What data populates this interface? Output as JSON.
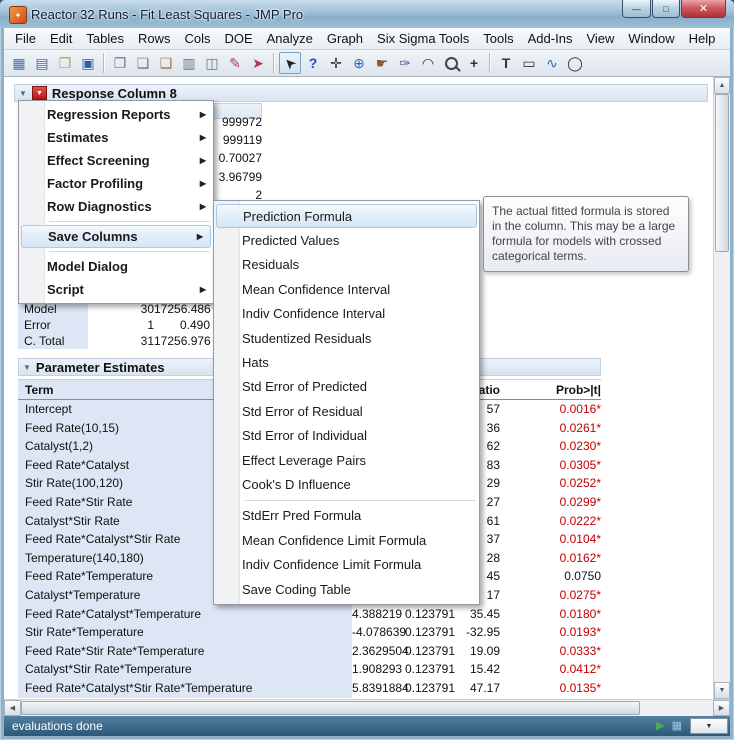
{
  "window": {
    "title": "Reactor 32 Runs - Fit Least Squares - JMP Pro",
    "controls": {
      "minimize": "—",
      "maximize": "□",
      "close": "✕"
    }
  },
  "menu_bar": {
    "items": [
      "File",
      "Edit",
      "Tables",
      "Rows",
      "Cols",
      "DOE",
      "Analyze",
      "Graph",
      "Six Sigma Tools",
      "Tools",
      "Add-Ins",
      "View",
      "Window",
      "Help"
    ]
  },
  "toolbar": {
    "groups": [
      [
        {
          "name": "new-data-table-icon",
          "glyph": "▦",
          "color": "#4a6fae"
        },
        {
          "name": "new-journal-icon",
          "glyph": "▤",
          "color": "#4a6fae"
        },
        {
          "name": "open-icon",
          "glyph": "❒",
          "color": "#c79b3b"
        },
        {
          "name": "save-icon",
          "glyph": "▣",
          "color": "#2f5fb0"
        }
      ],
      [
        {
          "name": "new-window-icon",
          "glyph": "❐",
          "color": "#6b7a8d"
        },
        {
          "name": "copy-icon",
          "glyph": "❏",
          "color": "#6b7a8d"
        },
        {
          "name": "paste-icon",
          "glyph": "❑",
          "color": "#9a7a4a"
        },
        {
          "name": "print-icon",
          "glyph": "▥",
          "color": "#667788"
        },
        {
          "name": "layout-icon",
          "glyph": "◫",
          "color": "#667788"
        },
        {
          "name": "annotate-icon",
          "glyph": "✎",
          "color": "#b23a48"
        },
        {
          "name": "run-script-icon",
          "glyph": "➤",
          "color": "#b23a48"
        }
      ],
      [
        {
          "name": "arrow-tool-icon",
          "glyph": "➤",
          "color": "#222222",
          "rot": -135,
          "active": true
        },
        {
          "name": "help-tool-icon",
          "glyph": "?",
          "color": "#1a4fc4"
        },
        {
          "name": "grabber-tool-icon",
          "glyph": "✛",
          "color": "#333333"
        },
        {
          "name": "globe-tool-icon",
          "glyph": "⊕",
          "color": "#2a6bb5"
        },
        {
          "name": "hand-tool-icon",
          "glyph": "☛",
          "color": "#8a5a2a"
        },
        {
          "name": "brush-tool-icon",
          "glyph": "✑",
          "color": "#7a4a9a"
        },
        {
          "name": "lasso-tool-icon",
          "glyph": "◠",
          "color": "#333333"
        },
        {
          "name": "magnifier-tool-icon",
          "glyph": "MAG"
        },
        {
          "name": "crosshair-tool-icon",
          "glyph": "+",
          "color": "#333333"
        }
      ],
      [
        {
          "name": "text-tool-icon",
          "glyph": "T",
          "color": "#333333"
        },
        {
          "name": "rect-tool-icon",
          "glyph": "▭",
          "color": "#333333"
        },
        {
          "name": "curve-tool-icon",
          "glyph": "∿",
          "color": "#2a6bb5"
        },
        {
          "name": "oval-tool-icon",
          "glyph": "◯",
          "color": "#333333"
        }
      ]
    ]
  },
  "report": {
    "response_title": "Response Column 8",
    "summary_values": [
      "999972",
      "999119",
      "0.70027",
      "3.96799",
      "2"
    ],
    "anova_rows": [
      [
        "Model",
        "30",
        "17256.486"
      ],
      [
        "Error",
        "1",
        "0.490"
      ],
      [
        "C. Total",
        "31",
        "17256.976"
      ]
    ],
    "param_estimates": {
      "title": "Parameter Estimates",
      "col_term": "Term",
      "col_t_ratio": "t Ratio",
      "col_prob": "Prob>|t|",
      "rows": [
        {
          "term": "Intercept",
          "estimate": "",
          "std_error": "",
          "t_ratio": "57",
          "prob": "0.0016*",
          "sig": true
        },
        {
          "term": "Feed Rate(10,15)",
          "estimate": "",
          "std_error": "",
          "t_ratio": "36",
          "prob": "0.0261*",
          "sig": true
        },
        {
          "term": "Catalyst(1,2)",
          "estimate": "",
          "std_error": "",
          "t_ratio": "62",
          "prob": "0.0230*",
          "sig": true
        },
        {
          "term": "Feed Rate*Catalyst",
          "estimate": "",
          "std_error": "",
          "t_ratio": "83",
          "prob": "0.0305*",
          "sig": true
        },
        {
          "term": "Stir Rate(100,120)",
          "estimate": "",
          "std_error": "",
          "t_ratio": "29",
          "prob": "0.0252*",
          "sig": true
        },
        {
          "term": "Feed Rate*Stir Rate",
          "estimate": "",
          "std_error": "",
          "t_ratio": "27",
          "prob": "0.0299*",
          "sig": true
        },
        {
          "term": "Catalyst*Stir Rate",
          "estimate": "",
          "std_error": "",
          "t_ratio": "61",
          "prob": "0.0222*",
          "sig": true
        },
        {
          "term": "Feed Rate*Catalyst*Stir Rate",
          "estimate": "",
          "std_error": "",
          "t_ratio": "37",
          "prob": "0.0104*",
          "sig": true
        },
        {
          "term": "Temperature(140,180)",
          "estimate": "",
          "std_error": "",
          "t_ratio": "28",
          "prob": "0.0162*",
          "sig": true
        },
        {
          "term": "Feed Rate*Temperature",
          "estimate": "",
          "std_error": "",
          "t_ratio": "45",
          "prob": "0.0750",
          "sig": false
        },
        {
          "term": "Catalyst*Temperature",
          "estimate": "",
          "std_error": "",
          "t_ratio": "17",
          "prob": "0.0275*",
          "sig": true
        },
        {
          "term": "Feed Rate*Catalyst*Temperature",
          "estimate": "4.388219",
          "std_error": "0.123791",
          "t_ratio": "35.45",
          "prob": "0.0180*",
          "sig": true
        },
        {
          "term": "Stir Rate*Temperature",
          "estimate": "-4.078639",
          "std_error": "0.123791",
          "t_ratio": "-32.95",
          "prob": "0.0193*",
          "sig": true
        },
        {
          "term": "Feed Rate*Stir Rate*Temperature",
          "estimate": "2.3629504",
          "std_error": "0.123791",
          "t_ratio": "19.09",
          "prob": "0.0333*",
          "sig": true
        },
        {
          "term": "Catalyst*Stir Rate*Temperature",
          "estimate": "1.908293",
          "std_error": "0.123791",
          "t_ratio": "15.42",
          "prob": "0.0412*",
          "sig": true
        },
        {
          "term": "Feed Rate*Catalyst*Stir Rate*Temperature",
          "estimate": "5.8391884",
          "std_error": "0.123791",
          "t_ratio": "47.17",
          "prob": "0.0135*",
          "sig": true
        }
      ]
    }
  },
  "red_triangle_menu": {
    "items": [
      {
        "label": "Regression Reports",
        "arrow": true
      },
      {
        "label": "Estimates",
        "arrow": true
      },
      {
        "label": "Effect Screening",
        "arrow": true
      },
      {
        "label": "Factor Profiling",
        "arrow": true
      },
      {
        "label": "Row Diagnostics",
        "arrow": true
      },
      {
        "type": "separator"
      },
      {
        "label": "Save Columns",
        "arrow": true,
        "highlighted": true
      },
      {
        "type": "separator"
      },
      {
        "label": "Model Dialog"
      },
      {
        "label": "Script",
        "arrow": true
      }
    ]
  },
  "save_columns_submenu": {
    "items": [
      {
        "label": "Prediction Formula",
        "highlighted": true
      },
      {
        "label": "Predicted Values"
      },
      {
        "label": "Residuals"
      },
      {
        "label": "Mean Confidence Interval"
      },
      {
        "label": "Indiv Confidence Interval"
      },
      {
        "label": "Studentized Residuals"
      },
      {
        "label": "Hats"
      },
      {
        "label": "Std Error of Predicted"
      },
      {
        "label": "Std Error of Residual"
      },
      {
        "label": "Std Error of Individual"
      },
      {
        "label": "Effect Leverage Pairs"
      },
      {
        "label": "Cook's D Influence"
      },
      {
        "type": "separator"
      },
      {
        "label": "StdErr Pred Formula"
      },
      {
        "label": "Mean Confidence Limit Formula"
      },
      {
        "label": "Indiv Confidence Limit Formula"
      },
      {
        "label": "Save Coding Table"
      }
    ]
  },
  "tooltip": {
    "text": "The actual fitted formula is stored in the column. This may be a large formula for models with crossed categorical terms."
  },
  "status_bar": {
    "text": "evaluations done",
    "icons": [
      {
        "name": "run-indicator-icon",
        "glyph": "▶",
        "color": "#49b04f"
      },
      {
        "name": "window-list-icon",
        "glyph": "▦",
        "color": "#9fc3e8"
      }
    ],
    "dropdown_glyph": "▼"
  },
  "colors": {
    "prob_significant": "#c00000",
    "term_column_bg": "#dce6f5",
    "status_bar_bg": "#2b5878",
    "menu_highlight_border": "#a9c9ea"
  }
}
